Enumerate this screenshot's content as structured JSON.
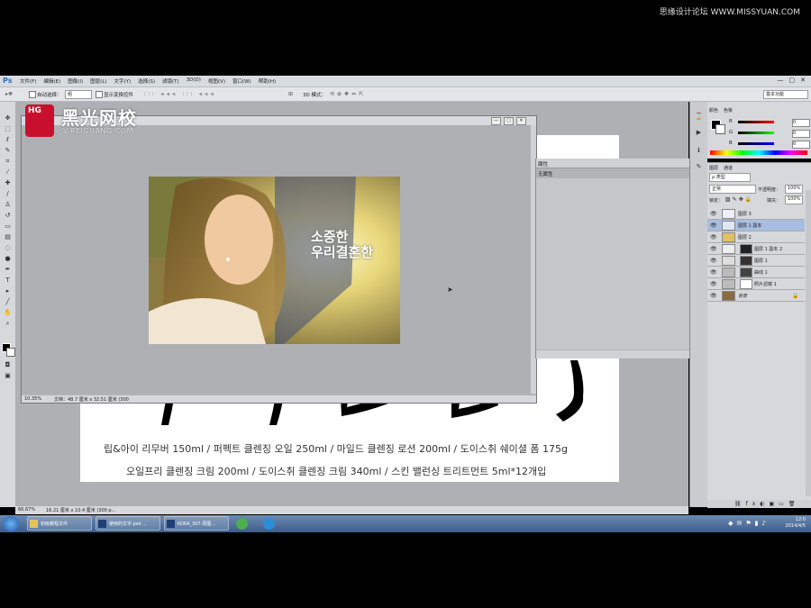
{
  "watermark": "思缘设计论坛  WWW.MISSYUAN.COM",
  "app": {
    "logo": "Ps"
  },
  "menu": [
    "文件(F)",
    "编辑(E)",
    "图像(I)",
    "图层(L)",
    "文字(Y)",
    "选择(S)",
    "滤镜(T)",
    "3D(D)",
    "视图(V)",
    "窗口(W)",
    "帮助(H)"
  ],
  "window_buttons": [
    "—",
    "▢",
    "✕"
  ],
  "options": {
    "auto_select_label": "自动选择：",
    "auto_select_value": "组",
    "show_transform_label": "显示变换控件",
    "mode_3d_label": "3D 模式：",
    "workspace": "基本功能"
  },
  "logo": {
    "badge": "HG",
    "brand": "黑光网校",
    "url": "V.REIGUANG.COM"
  },
  "docwin": {
    "zoom": "10.35%",
    "info": "文档：48.7 厘米 x 32.51 厘米 (300"
  },
  "background_doc": {
    "line1": "립&아이 리무버 150ml / 퍼펙트 클렌징 오일 250ml / 마일드 클렌징 로션 200ml / 도이스취 쉐이셜 폼 175g",
    "line2": "오일프리 클렌징 크림 200ml / 도이스취 클렌징 크림 340ml / 스킨 밸런싱 트리트먼트 5ml*12개입",
    "zoom": "66.67%",
    "info": "16.21 厘米 x 10.4 厘米 (300 p..."
  },
  "photo": {
    "title_line1": "소중한",
    "title_line2": "우리결혼한"
  },
  "properties": {
    "tab": "属性",
    "content": "无属性"
  },
  "color": {
    "tabs": [
      "颜色",
      "色板"
    ],
    "channels": [
      {
        "name": "R",
        "value": "0"
      },
      {
        "name": "G",
        "value": "0"
      },
      {
        "name": "B",
        "value": "0"
      }
    ]
  },
  "layers": {
    "tabs": [
      "图层",
      "通道"
    ],
    "filter": "ρ 类型",
    "blend": "正常",
    "opacity_label": "不透明度：",
    "opacity": "100%",
    "lock_label": "锁定：",
    "fill_label": "填充：",
    "fill": "100%",
    "items": [
      {
        "name": "图层 3",
        "selected": false
      },
      {
        "name": "图层 1 副本",
        "selected": true
      },
      {
        "name": "图层 2",
        "selected": false
      },
      {
        "name": "图层 1 副本 2",
        "selected": false
      },
      {
        "name": "图层 1",
        "selected": false
      },
      {
        "name": "曲线 1",
        "selected": false
      },
      {
        "name": "照片滤镜 1",
        "selected": false
      },
      {
        "name": "背景",
        "selected": false
      }
    ]
  },
  "taskbar": {
    "tasks": [
      "初级教程文件",
      "使用的文字.psd ...",
      "KOKA_307-原图..."
    ],
    "time": "12:0",
    "date": "2014/4/5"
  }
}
